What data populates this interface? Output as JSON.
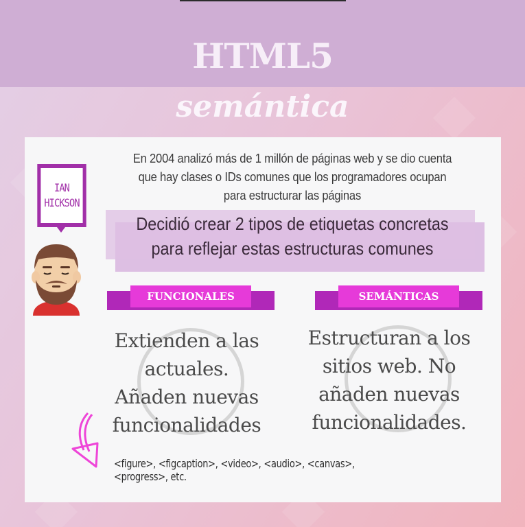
{
  "header": {
    "title": "HTML5",
    "subtitle": "semántica"
  },
  "person": {
    "name_line1": "IAN",
    "name_line2": "HICKSON"
  },
  "intro": {
    "line1": "En 2004 analizó más de 1 millón de páginas web y se dio cuenta",
    "line2": "que hay clases o IDs comunes que los programadores ocupan",
    "line3": "para estructurar las páginas"
  },
  "highlight": {
    "line1": "Decidió crear 2 tipos de etiquetas concretas",
    "line2": "para reflejar estas estructuras comunes"
  },
  "columns": [
    {
      "label": "FUNCIONALES",
      "lines": [
        "Extienden a las",
        "actuales.",
        "Añaden nuevas",
        "funcionalidades"
      ]
    },
    {
      "label": "SEMÁNTICAS",
      "lines": [
        "Estructuran a los",
        "sitios web. No",
        "añaden nuevas",
        "funcionalidades."
      ]
    }
  ],
  "examples": "<figure>, <figcaption>, <video>, <audio>, <canvas>, <progress>, etc.",
  "colors": {
    "band": "#cfaed4",
    "accent": "#a12fa8",
    "ribbon": "#e63ad9",
    "arrow": "#ee45d8"
  }
}
